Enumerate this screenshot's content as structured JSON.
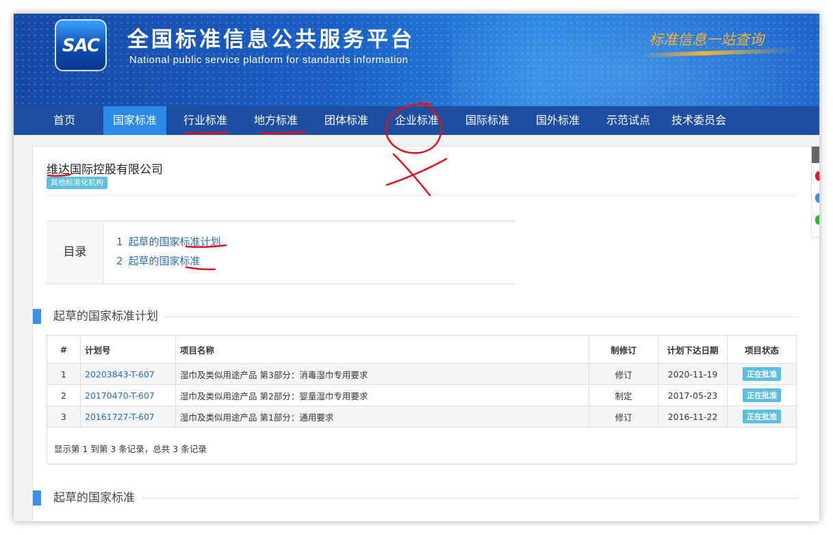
{
  "header": {
    "logo_text": "SAC",
    "title": "全国标准信息公共服务平台",
    "subtitle": "National public service platform  for standards information",
    "slogan": "标准信息一站查询"
  },
  "nav": {
    "items": [
      {
        "label": "首页",
        "active": false
      },
      {
        "label": "国家标准",
        "active": true
      },
      {
        "label": "行业标准",
        "active": false
      },
      {
        "label": "地方标准",
        "active": false
      },
      {
        "label": "团体标准",
        "active": false
      },
      {
        "label": "企业标准",
        "active": false
      },
      {
        "label": "国际标准",
        "active": false
      },
      {
        "label": "国外标准",
        "active": false
      },
      {
        "label": "示范试点",
        "active": false
      },
      {
        "label": "技术委员会",
        "active": false
      }
    ]
  },
  "org": {
    "name": "维达国际控股有限公司",
    "badge": "其他标准化机构"
  },
  "toc": {
    "label": "目录",
    "items": [
      {
        "num": "1",
        "label": "起草的国家标准计划"
      },
      {
        "num": "2",
        "label": "起草的国家标准"
      }
    ]
  },
  "section1": {
    "title": "起草的国家标准计划",
    "columns": [
      "#",
      "计划号",
      "项目名称",
      "制修订",
      "计划下达日期",
      "项目状态"
    ],
    "rows": [
      {
        "idx": "1",
        "plan_no": "20203843-T-607",
        "name": "湿巾及类似用途产品 第3部分：消毒湿巾专用要求",
        "type": "修订",
        "date": "2020-11-19",
        "status": "正在批准"
      },
      {
        "idx": "2",
        "plan_no": "20170470-T-607",
        "name": "湿巾及类似用途产品 第2部分：婴童湿巾专用要求",
        "type": "制定",
        "date": "2017-05-23",
        "status": "正在批准"
      },
      {
        "idx": "3",
        "plan_no": "20161727-T-607",
        "name": "湿巾及类似用途产品 第1部分：通用要求",
        "type": "修订",
        "date": "2016-11-22",
        "status": "正在批准"
      }
    ],
    "footer": "显示第 1 到第 3 条记录，总共 3 条记录"
  },
  "section2": {
    "title": "起草的国家标准"
  },
  "colors": {
    "nav_bg": "#1d4ea0",
    "nav_active": "#2a8ae6",
    "link": "#2a6eb8",
    "badge": "#5bc0de",
    "annotation": "#e0101c"
  }
}
